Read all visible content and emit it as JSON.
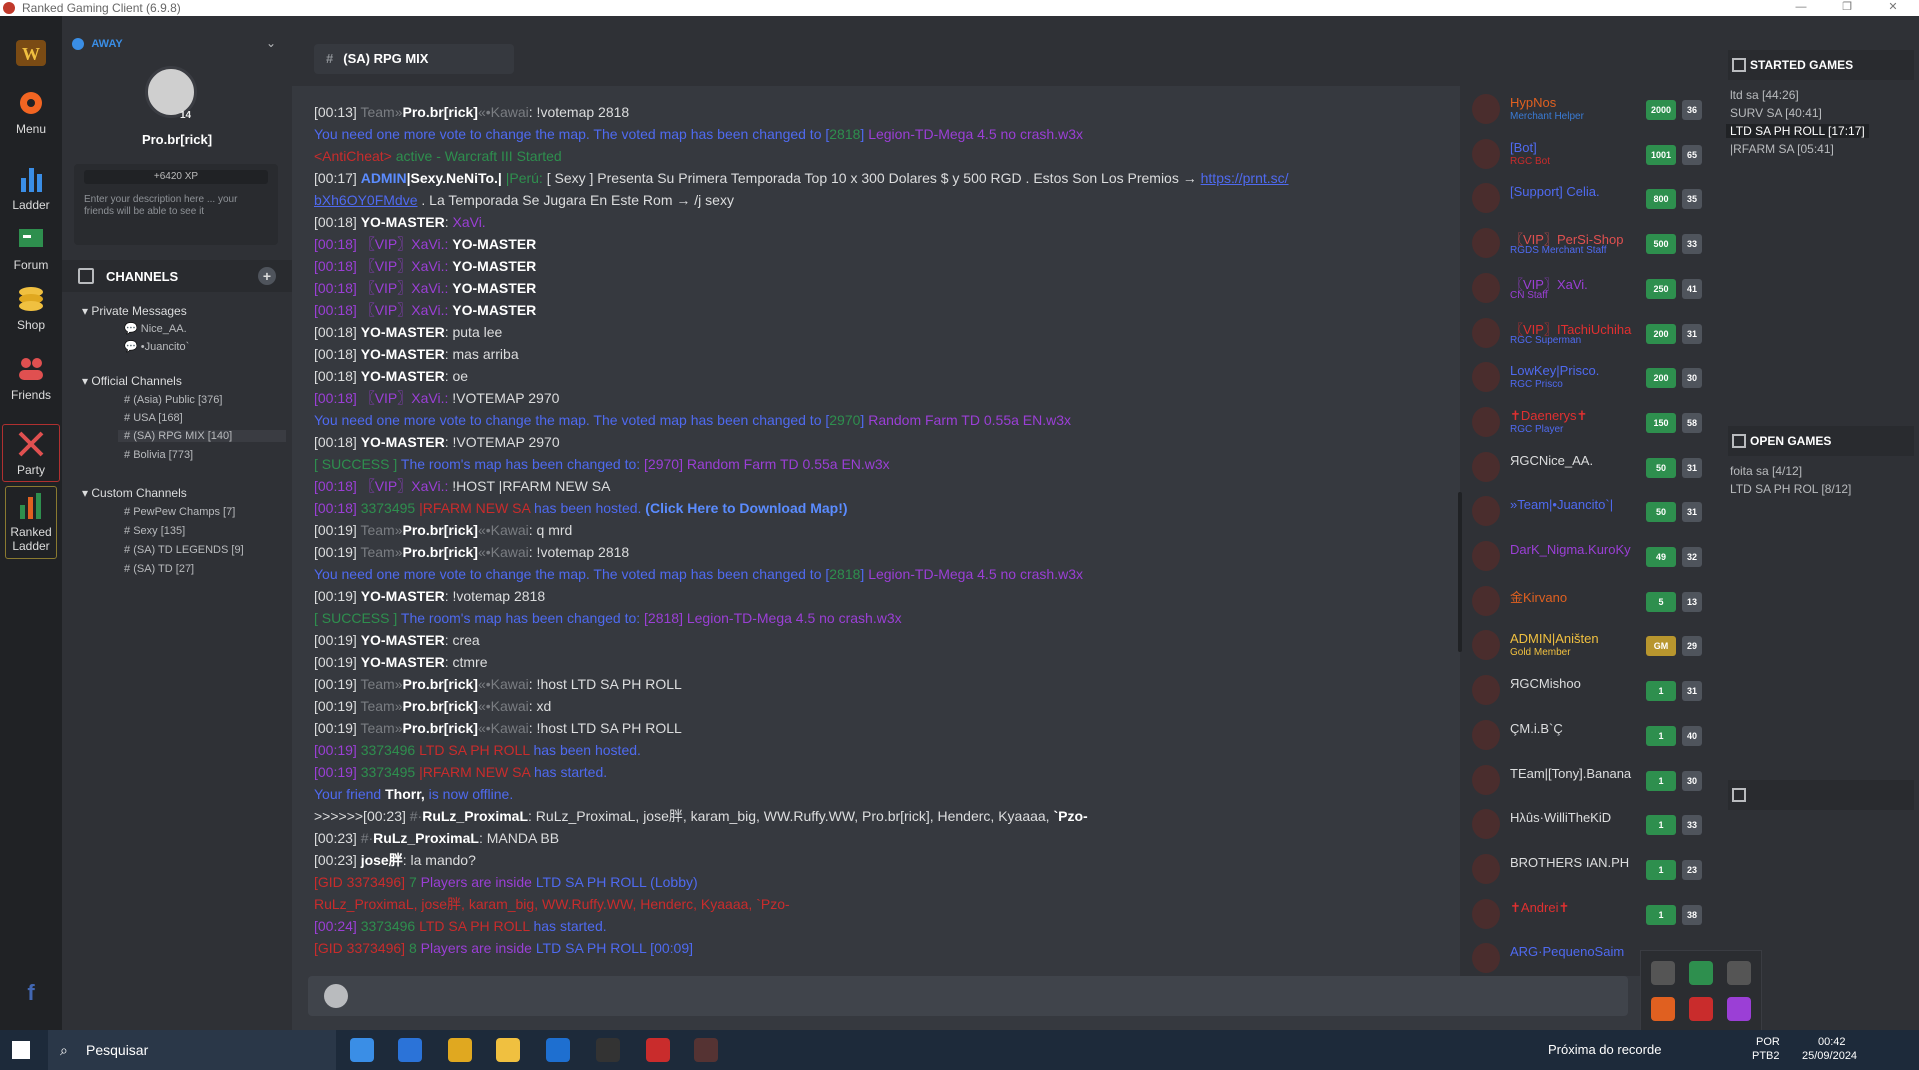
{
  "app": {
    "title": "Ranked Gaming Client (6.9.8)"
  },
  "nav": [
    "Menu",
    "Ladder",
    "Forum",
    "Shop",
    "Friends",
    "Party",
    "Ranked Ladder"
  ],
  "profile": {
    "status": "AWAY",
    "level": "14",
    "username": "Pro.br[rick]",
    "xp": "+6420 XP",
    "description": "Enter your description here ... your friends will be able to see it"
  },
  "channels": {
    "title": "CHANNELS",
    "private_title": "Private Messages",
    "private": [
      "Nice_AA.",
      "•Juancito`"
    ],
    "official_title": "Official Channels",
    "official": [
      "(Asia) Public [376]",
      "USA [168]",
      "(SA) RPG MIX [140]",
      "Bolivia [773]"
    ],
    "custom_title": "Custom Channels",
    "custom": [
      "PewPew Champs [7]",
      "Sexy [135]",
      "(SA) TD LEGENDS [9]",
      "(SA) TD [27]"
    ]
  },
  "main": {
    "tab": "(SA) RPG MIX"
  },
  "messages": [
    [
      [
        "[00:13] ",
        "c-white"
      ],
      [
        "Team»",
        "c-gray"
      ],
      [
        "Pro.br[rick]",
        "c-bold"
      ],
      [
        "«•Kawai",
        "c-gray"
      ],
      [
        ": !votemap 2818",
        "c-white"
      ]
    ],
    [
      [
        "You need one more vote to change the map. The voted map has been changed to [",
        "c-blue"
      ],
      [
        "2818",
        "c-green"
      ],
      [
        "] ",
        "c-blue"
      ],
      [
        "Legion-TD-Mega 4.5 no crash.w3x",
        "c-purple"
      ]
    ],
    [
      [
        "<AntiCheat> ",
        "c-red"
      ],
      [
        "active",
        "c-green"
      ],
      [
        " - Warcraft III Started",
        "c-green"
      ]
    ],
    [
      [
        "[00:17] ",
        "c-white"
      ],
      [
        "ADMIN",
        "c-lblue"
      ],
      [
        "|Sexy.NeNiTo.|",
        "c-bold"
      ],
      [
        " |Perú: ",
        "c-green"
      ],
      [
        "[ Sexy ] Presenta Su Primera Temporada Top 10 x 300 Dolares $ y 500 RGD . Estos Son Los Premios → ",
        "c-white"
      ],
      [
        "https://prnt.sc/",
        "c-link"
      ]
    ],
    [
      [
        "bXh6OY0FMdve",
        "c-link"
      ],
      [
        " . La Temporada Se Jugara En Este Rom → /j sexy",
        "c-white"
      ]
    ],
    [
      [
        "[00:18] ",
        "c-white"
      ],
      [
        "YO-MASTER",
        "c-bold"
      ],
      [
        ": ",
        "c-white"
      ],
      [
        "XaVi.",
        "c-purple"
      ]
    ],
    [
      [
        "[00:18] ",
        "c-purple"
      ],
      [
        "〖VIP〗XaVi.",
        "c-purple"
      ],
      [
        ": ",
        "c-purple"
      ],
      [
        "YO-MASTER",
        "c-bold"
      ]
    ],
    [
      [
        "[00:18] ",
        "c-purple"
      ],
      [
        "〖VIP〗XaVi.",
        "c-purple"
      ],
      [
        ": ",
        "c-purple"
      ],
      [
        "YO-MASTER",
        "c-bold"
      ]
    ],
    [
      [
        "[00:18] ",
        "c-purple"
      ],
      [
        "〖VIP〗XaVi.",
        "c-purple"
      ],
      [
        ": ",
        "c-purple"
      ],
      [
        "YO-MASTER",
        "c-bold"
      ]
    ],
    [
      [
        "[00:18] ",
        "c-purple"
      ],
      [
        "〖VIP〗XaVi.",
        "c-purple"
      ],
      [
        ": ",
        "c-purple"
      ],
      [
        "YO-MASTER",
        "c-bold"
      ]
    ],
    [
      [
        "[00:18] ",
        "c-white"
      ],
      [
        "YO-MASTER",
        "c-bold"
      ],
      [
        ": puta lee",
        "c-white"
      ]
    ],
    [
      [
        "[00:18] ",
        "c-white"
      ],
      [
        "YO-MASTER",
        "c-bold"
      ],
      [
        ": mas arriba",
        "c-white"
      ]
    ],
    [
      [
        "[00:18] ",
        "c-white"
      ],
      [
        "YO-MASTER",
        "c-bold"
      ],
      [
        ": oe",
        "c-white"
      ]
    ],
    [
      [
        "[00:18] ",
        "c-purple"
      ],
      [
        "〖VIP〗XaVi.",
        "c-purple"
      ],
      [
        ": ",
        "c-purple"
      ],
      [
        "!VOTEMAP 2970",
        "c-white"
      ]
    ],
    [
      [
        "You need one more vote to change the map. The voted map has been changed to [",
        "c-blue"
      ],
      [
        "2970",
        "c-green"
      ],
      [
        "] ",
        "c-blue"
      ],
      [
        "Random Farm TD 0.55a EN.w3x",
        "c-purple"
      ]
    ],
    [
      [
        "[00:18] ",
        "c-white"
      ],
      [
        "YO-MASTER",
        "c-bold"
      ],
      [
        ": !VOTEMAP 2970",
        "c-white"
      ]
    ],
    [
      [
        "[ SUCCESS ] ",
        "c-green"
      ],
      [
        "The room's map has been changed to: ",
        "c-blue"
      ],
      [
        "[2970] Random Farm TD 0.55a EN.w3x",
        "c-purple"
      ]
    ],
    [
      [
        "[00:18] ",
        "c-purple"
      ],
      [
        "〖VIP〗XaVi.",
        "c-purple"
      ],
      [
        ": ",
        "c-purple"
      ],
      [
        "!HOST |RFARM NEW SA",
        "c-white"
      ]
    ],
    [
      [
        "[00:18] ",
        "c-purple"
      ],
      [
        "3373495",
        "c-green"
      ],
      [
        " |RFARM NEW SA",
        "c-red"
      ],
      [
        " has been hosted. ",
        "c-blue"
      ],
      [
        "(Click Here to Download Map!)",
        "c-lblue"
      ]
    ],
    [
      [
        "[00:19] ",
        "c-white"
      ],
      [
        "Team»",
        "c-gray"
      ],
      [
        "Pro.br[rick]",
        "c-bold"
      ],
      [
        "«•Kawai",
        "c-gray"
      ],
      [
        ": q mrd",
        "c-white"
      ]
    ],
    [
      [
        "[00:19] ",
        "c-white"
      ],
      [
        "Team»",
        "c-gray"
      ],
      [
        "Pro.br[rick]",
        "c-bold"
      ],
      [
        "«•Kawai",
        "c-gray"
      ],
      [
        ": !votemap 2818",
        "c-white"
      ]
    ],
    [
      [
        "You need one more vote to change the map. The voted map has been changed to [",
        "c-blue"
      ],
      [
        "2818",
        "c-green"
      ],
      [
        "] ",
        "c-blue"
      ],
      [
        "Legion-TD-Mega 4.5 no crash.w3x",
        "c-purple"
      ]
    ],
    [
      [
        "[00:19] ",
        "c-white"
      ],
      [
        "YO-MASTER",
        "c-bold"
      ],
      [
        ": !votemap 2818",
        "c-white"
      ]
    ],
    [
      [
        "[ SUCCESS ] ",
        "c-green"
      ],
      [
        "The room's map has been changed to: ",
        "c-blue"
      ],
      [
        "[2818] Legion-TD-Mega 4.5 no crash.w3x",
        "c-purple"
      ]
    ],
    [
      [
        "[00:19] ",
        "c-white"
      ],
      [
        "YO-MASTER",
        "c-bold"
      ],
      [
        ": crea",
        "c-white"
      ]
    ],
    [
      [
        "[00:19] ",
        "c-white"
      ],
      [
        "YO-MASTER",
        "c-bold"
      ],
      [
        ": ctmre",
        "c-white"
      ]
    ],
    [
      [
        "[00:19] ",
        "c-white"
      ],
      [
        "Team»",
        "c-gray"
      ],
      [
        "Pro.br[rick]",
        "c-bold"
      ],
      [
        "«•Kawai",
        "c-gray"
      ],
      [
        ": !host LTD SA PH ROLL",
        "c-white"
      ]
    ],
    [
      [
        "[00:19] ",
        "c-white"
      ],
      [
        "Team»",
        "c-gray"
      ],
      [
        "Pro.br[rick]",
        "c-bold"
      ],
      [
        "«•Kawai",
        "c-gray"
      ],
      [
        ": xd",
        "c-white"
      ]
    ],
    [
      [
        "[00:19] ",
        "c-white"
      ],
      [
        "Team»",
        "c-gray"
      ],
      [
        "Pro.br[rick]",
        "c-bold"
      ],
      [
        "«•Kawai",
        "c-gray"
      ],
      [
        ": !host LTD SA PH ROLL",
        "c-white"
      ]
    ],
    [
      [
        "[00:19] ",
        "c-purple"
      ],
      [
        "3373496",
        "c-green"
      ],
      [
        " LTD SA PH ROLL",
        "c-red"
      ],
      [
        " has been hosted.",
        "c-blue"
      ]
    ],
    [
      [
        "[00:19] ",
        "c-purple"
      ],
      [
        "3373495",
        "c-green"
      ],
      [
        " |RFARM NEW SA",
        "c-red"
      ],
      [
        " has started.",
        "c-blue"
      ]
    ],
    [
      [
        "Your friend ",
        "c-blue"
      ],
      [
        "Thorr,",
        "c-bold"
      ],
      [
        " is now offline.",
        "c-blue"
      ]
    ],
    [
      [
        ">>>>>>[00:23] ",
        "c-white"
      ],
      [
        "#·",
        "c-gray"
      ],
      [
        "RuLz_ProximaL",
        "c-bold"
      ],
      [
        ": RuLz_ProximaL, jose胖, karam_big, WW.Ruffy.WW, Pro.br[rick], Henderc, Kyaaaa, ",
        "c-white"
      ],
      [
        "`Pzo-",
        "c-bold"
      ]
    ],
    [
      [
        "[00:23] ",
        "c-white"
      ],
      [
        "#·",
        "c-gray"
      ],
      [
        "RuLz_ProximaL",
        "c-bold"
      ],
      [
        ": MANDA BB",
        "c-white"
      ]
    ],
    [
      [
        "[00:23] ",
        "c-white"
      ],
      [
        "jose胖",
        "c-bold"
      ],
      [
        ": la mando?",
        "c-white"
      ]
    ],
    [
      [
        "[GID 3373496] ",
        "c-red"
      ],
      [
        "7",
        "c-green"
      ],
      [
        " Players are inside ",
        "c-purple"
      ],
      [
        "LTD SA PH ROLL (Lobby)",
        "c-blue"
      ]
    ],
    [
      [
        "RuLz_ProximaL, jose胖, karam_big, WW.Ruffy.WW, Henderc, Kyaaaa, `Pzo-",
        "c-red"
      ]
    ],
    [
      [
        "[00:24] ",
        "c-purple"
      ],
      [
        "3373496",
        "c-green"
      ],
      [
        " LTD SA PH ROLL",
        "c-red"
      ],
      [
        " has started.",
        "c-blue"
      ]
    ],
    [
      [
        "[GID 3373496] ",
        "c-red"
      ],
      [
        "8",
        "c-green"
      ],
      [
        " Players are inside ",
        "c-purple"
      ],
      [
        "LTD SA PH ROLL [00:09]",
        "c-blue"
      ]
    ]
  ],
  "users": [
    {
      "name": "HypNos",
      "title": "Merchant Helper",
      "color": "#e06020",
      "tcolor": "#3a7bd5",
      "b1": "2000",
      "b2": "36"
    },
    {
      "name": "[Bot]",
      "title": "RGC Bot",
      "color": "#4f6af0",
      "tcolor": "#c92c2c",
      "b1": "1001",
      "b2": "65"
    },
    {
      "name": "[Support] Celia.",
      "title": "",
      "color": "#4f6af0",
      "tcolor": "#e06020",
      "b1": "800",
      "b2": "35"
    },
    {
      "name": "〖VIP〗PerSi-Shop",
      "title": "RGDS Merchant Staff",
      "color": "#e05050",
      "tcolor": "#4f6af0",
      "b1": "500",
      "b2": "33"
    },
    {
      "name": "〖VIP〗XaVi.",
      "title": "CN Staff",
      "color": "#9b3fd6",
      "tcolor": "#9b3fd6",
      "b1": "250",
      "b2": "41"
    },
    {
      "name": "〖VIP〗ITachiUchiha",
      "title": "RGC Superman",
      "color": "#e03030",
      "tcolor": "#4f6af0",
      "b1": "200",
      "b2": "31"
    },
    {
      "name": "LowKey|Prisco.",
      "title": "RGC Prisco",
      "color": "#4f6af0",
      "tcolor": "#4f6af0",
      "b1": "200",
      "b2": "30"
    },
    {
      "name": "✝Daenerys✝",
      "title": "RGC Player",
      "color": "#e03030",
      "tcolor": "#4f6af0",
      "b1": "150",
      "b2": "58"
    },
    {
      "name": "ЯGCNice_AA.",
      "title": "",
      "color": "#dcddde",
      "tcolor": "#dcddde",
      "b1": "50",
      "b2": "31"
    },
    {
      "name": "»Team|•Juancito`|",
      "title": "",
      "color": "#4f6af0",
      "tcolor": "#dcddde",
      "b1": "50",
      "b2": "31"
    },
    {
      "name": "DarK_Nigma.KuroKy",
      "title": "",
      "color": "#9b3fd6",
      "tcolor": "#dcddde",
      "b1": "49",
      "b2": "32"
    },
    {
      "name": "金Kirvano",
      "title": "",
      "color": "#e06020",
      "tcolor": "#dcddde",
      "b1": "5",
      "b2": "13"
    },
    {
      "name": "ADMIN|Aništen",
      "title": "Gold Member",
      "color": "#f0c040",
      "tcolor": "#f0c040",
      "b1": "GM",
      "b2": "29"
    },
    {
      "name": "ЯGCMishoo",
      "title": "",
      "color": "#dcddde",
      "tcolor": "#dcddde",
      "b1": "1",
      "b2": "31"
    },
    {
      "name": "ÇM.i.B`Ç",
      "title": "",
      "color": "#dcddde",
      "tcolor": "#dcddde",
      "b1": "1",
      "b2": "40"
    },
    {
      "name": "TEam|[Tony].Banana",
      "title": "",
      "color": "#dcddde",
      "tcolor": "#dcddde",
      "b1": "1",
      "b2": "30"
    },
    {
      "name": "Hλûs·WilliTheKiD",
      "title": "",
      "color": "#dcddde",
      "tcolor": "#dcddde",
      "b1": "1",
      "b2": "33"
    },
    {
      "name": "BROTHERS IAN.PH",
      "title": "",
      "color": "#dcddde",
      "tcolor": "#dcddde",
      "b1": "1",
      "b2": "23"
    },
    {
      "name": "✝Andrei✝",
      "title": "",
      "color": "#e03030",
      "tcolor": "#dcddde",
      "b1": "1",
      "b2": "38"
    },
    {
      "name": "ARG·PequenoSaim",
      "title": "",
      "color": "#4f6af0",
      "tcolor": "#dcddde",
      "b1": "",
      "b2": ""
    }
  ],
  "games": {
    "started_title": "STARTED GAMES",
    "started": [
      "ltd sa [44:26]",
      "SURV SA [40:41]",
      "LTD SA PH ROLL [17:17]",
      "|RFARM SA [05:41]"
    ],
    "open_title": "OPEN GAMES",
    "open": [
      "foita sa [4/12]",
      "LTD SA PH ROL [8/12]"
    ]
  },
  "taskbar": {
    "search_placeholder": "Pesquisar",
    "weather": "Próxima do recorde",
    "lang1": "POR",
    "lang2": "PTB2",
    "time": "00:42",
    "date": "25/09/2024"
  }
}
